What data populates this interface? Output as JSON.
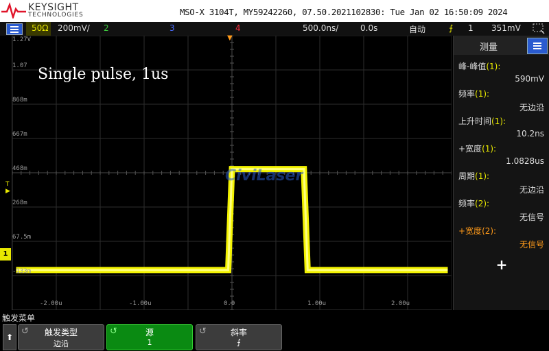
{
  "header": {
    "brand": "KEYSIGHT",
    "brand_sub": "TECHNOLOGIES",
    "device": "MSO-X 3104T, MY59242260, 07.50.2021102830: Tue Jan 02 16:50:09 2024"
  },
  "status": {
    "impedance": "50Ω",
    "ch1_scale": "200mV/",
    "ch2": "2",
    "ch3": "3",
    "ch4": "4",
    "timebase": "500.0ns/",
    "delay": "0.0s",
    "trigger_mode": "自动",
    "trigger_slope_symbol": "⨍",
    "trigger_source": "1",
    "trigger_level": "351mV"
  },
  "plot": {
    "annotation": "Single pulse, 1us",
    "watermark": "CiviLaser",
    "y_ticks": [
      "1.27V",
      "1.07",
      "868m",
      "667m",
      "468m",
      "268m",
      "67.5m",
      "-133m"
    ],
    "x_ticks": [
      "-2.00u",
      "-1.00u",
      "0.0",
      "1.00u",
      "2.00u"
    ],
    "ground_marker": "1"
  },
  "colors": {
    "ch1": "#ffff00",
    "ch2": "#3ec83e",
    "ch3": "#4a6cff",
    "ch4": "#ff3040",
    "accent": "#2a5bd0"
  },
  "chart_data": {
    "type": "line",
    "x": [
      -2.8,
      0.0,
      0.05,
      1.0,
      1.05,
      2.9
    ],
    "y": [
      0.0,
      0.0,
      0.59,
      0.59,
      0.0,
      0.0
    ],
    "xlabel": "",
    "ylabel": "",
    "ylim": [
      -0.233,
      1.37
    ],
    "xlim": [
      -2.85,
      2.95
    ],
    "grid": true,
    "series": [
      {
        "name": "1",
        "color": "#ffff00"
      }
    ]
  },
  "measurements": {
    "title": "测量",
    "items": [
      {
        "label": "峰-峰值",
        "ch": "(1):",
        "value": "590mV",
        "highlight": false
      },
      {
        "label": "频率",
        "ch": "(1):",
        "value": "无边沿",
        "highlight": false
      },
      {
        "label": "上升时间",
        "ch": "(1):",
        "value": "10.2ns",
        "highlight": false
      },
      {
        "label": "+宽度",
        "ch": "(1):",
        "value": "1.0828us",
        "highlight": false
      },
      {
        "label": "周期",
        "ch": "(1):",
        "value": "无边沿",
        "highlight": false
      },
      {
        "label": "频率",
        "ch": "(2):",
        "value": "无信号",
        "highlight": false
      },
      {
        "label": "+宽度",
        "ch": "(2):",
        "value": "无信号",
        "highlight": true
      }
    ],
    "add": "+"
  },
  "softkeys": {
    "title": "触发菜单",
    "up": "⬆",
    "keys": [
      {
        "l1": "触发类型",
        "l2": "边沿"
      },
      {
        "l1": "源",
        "l2": "1"
      },
      {
        "l1": "斜率",
        "l2": "⨍"
      }
    ]
  }
}
